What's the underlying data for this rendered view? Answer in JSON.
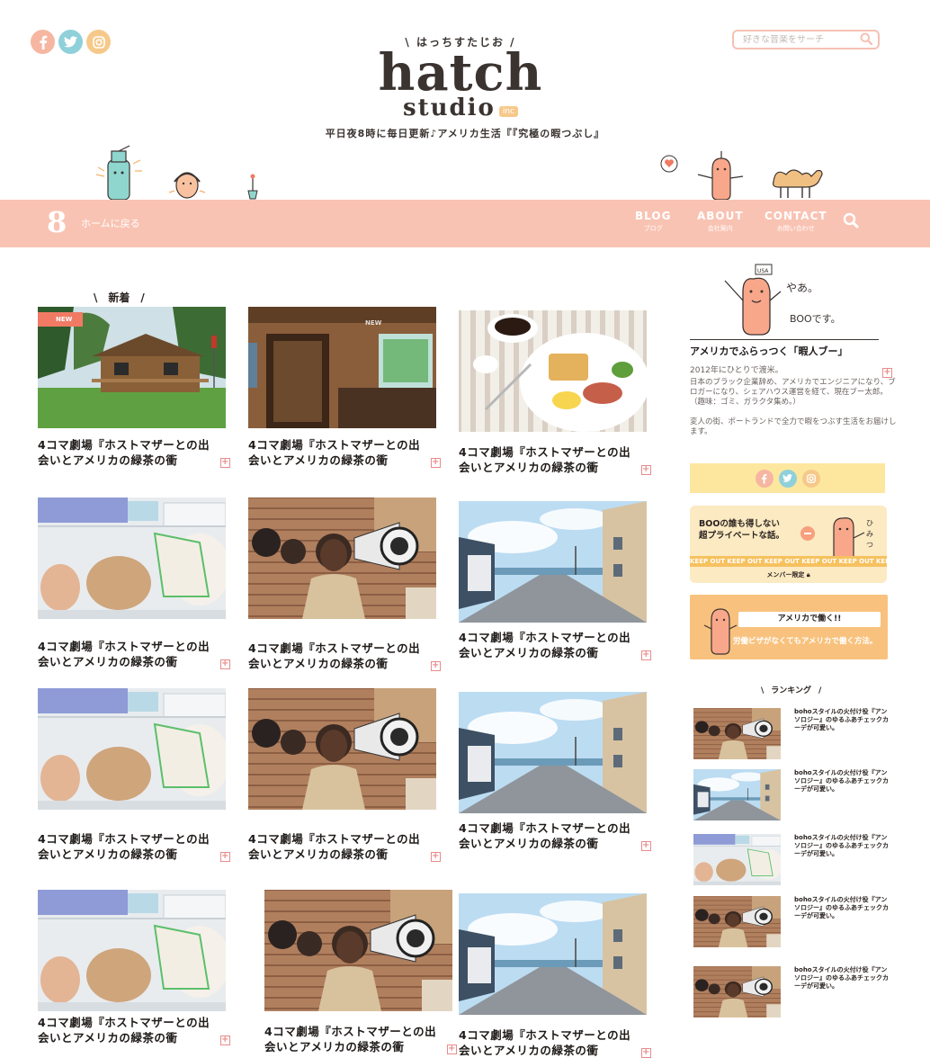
{
  "site": {
    "logo_kana": "はっちすたじお",
    "logo_main": "hatch",
    "logo_sub": "studio",
    "logo_inc": "inc",
    "tagline": "平日夜8時に毎日更新♪アメリカ生活『『究極の暇つぶし』"
  },
  "search": {
    "placeholder": "好きな音楽をサーチ"
  },
  "social": [
    {
      "name": "facebook-icon",
      "glyph": "f"
    },
    {
      "name": "twitter-icon",
      "glyph": "t"
    },
    {
      "name": "instagram-icon",
      "glyph": "i"
    }
  ],
  "nav": {
    "number": "8",
    "home": "ホームに戻る",
    "items": [
      {
        "en": "BLOG",
        "ja": "ブログ"
      },
      {
        "en": "ABOUT",
        "ja": "会社案内"
      },
      {
        "en": "CONTACT",
        "ja": "お問い合わせ"
      }
    ]
  },
  "section": {
    "newest": "新着",
    "new_badge": "NEW"
  },
  "posts": [
    {
      "title": "4コマ劇場『ホストマザーとの出会いとアメリカの緑茶の衝",
      "image": "cabin",
      "badge": "NEW"
    },
    {
      "title": "4コマ劇場『ホストマザーとの出会いとアメリカの緑茶の衝",
      "image": "interior",
      "badge": "NEW"
    },
    {
      "title": "4コマ劇場『ホストマザーとの出会いとアメリカの緑茶の衝",
      "image": "breakfast"
    },
    {
      "title": "4コマ劇場『ホストマザーとの出会いとアメリカの緑茶の衝",
      "image": "fridge"
    },
    {
      "title": "4コマ劇場『ホストマザーとの出会いとアメリカの緑茶の衝",
      "image": "protest"
    },
    {
      "title": "4コマ劇場『ホストマザーとの出会いとアメリカの緑茶の衝",
      "image": "harbor"
    },
    {
      "title": "4コマ劇場『ホストマザーとの出会いとアメリカの緑茶の衝",
      "image": "fridge"
    },
    {
      "title": "4コマ劇場『ホストマザーとの出会いとアメリカの緑茶の衝",
      "image": "protest"
    },
    {
      "title": "4コマ劇場『ホストマザーとの出会いとアメリカの緑茶の衝",
      "image": "harbor"
    },
    {
      "title": "4コマ劇場『ホストマザーとの出会いとアメリカの緑茶の衝",
      "image": "fridge"
    },
    {
      "title": "4コマ劇場『ホストマザーとの出会いとアメリカの緑茶の衝",
      "image": "protest"
    },
    {
      "title": "4コマ劇場『ホストマザーとの出会いとアメリカの緑茶の衝",
      "image": "harbor"
    }
  ],
  "sidebar": {
    "profile": {
      "handwriting": "やあ。BOOです。",
      "name": "アメリカでふらっつく「暇人ブー」",
      "since": "2012年にひとりで渡米。",
      "bio1": "日本のブラック企業辞め、アメリカでエンジニアになり、ブロガーになり、シェアハウス運営を経て、現在ブー太郎。（趣味：ゴミ、ガラクタ集め。）",
      "bio2": "変人の街、ポートランドで全力で暇をつぶす生活をお届けします。"
    },
    "private": {
      "line1": "BOOの誰も得しない",
      "line2": "超プライベートな話。",
      "keep": "KEEP OUT KEEP OUT KEEP OUT KEEP OUT KEEP OUT KEEP OUT KEEP OUT",
      "member": "メンバー限定"
    },
    "work": {
      "button": "アメリカで働く!!",
      "text": "労働ビザがなくてもアメリカで働く方法。"
    },
    "ranking": {
      "title": "ランキング",
      "items": [
        {
          "text": "bohoスタイルの火付け役『アンソロジー』のゆるふあチェックカーデが可愛い。",
          "image": "protest"
        },
        {
          "text": "bohoスタイルの火付け役『アンソロジー』のゆるふあチェックカーデが可愛い。",
          "image": "harbor"
        },
        {
          "text": "bohoスタイルの火付け役『アンソロジー』のゆるふあチェックカーデが可愛い。",
          "image": "fridge"
        },
        {
          "text": "bohoスタイルの火付け役『アンソロジー』のゆるふあチェックカーデが可愛い。",
          "image": "protest"
        },
        {
          "text": "bohoスタイルの火付け役『アンソロジー』のゆるふあチェックカーデが可愛い。",
          "image": "protest"
        }
      ]
    }
  },
  "colors": {
    "nav_bg": "#f9c3b3",
    "accent": "#f07a64",
    "sidebar_yellow": "#fde79f",
    "sidebar_orange": "#f8c27e"
  }
}
